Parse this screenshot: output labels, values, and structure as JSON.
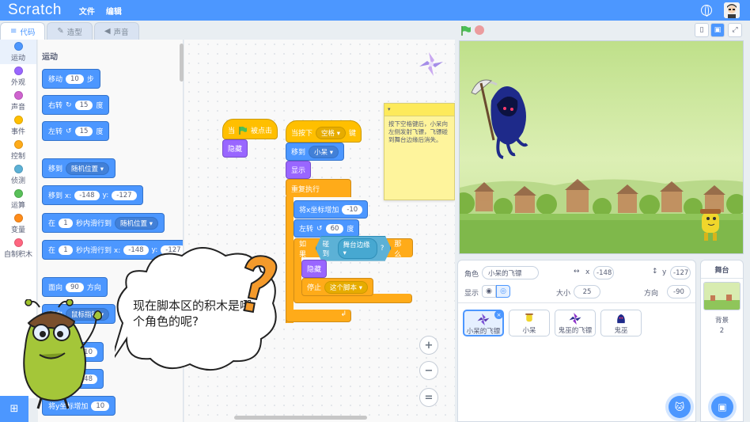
{
  "menu": {
    "logo": "Scratch",
    "file": "文件",
    "edit": "编辑"
  },
  "tabs": {
    "code": "代码",
    "costumes": "造型",
    "sounds": "声音"
  },
  "categories": [
    {
      "label": "运动",
      "color": "#4c97ff"
    },
    {
      "label": "外观",
      "color": "#9966ff"
    },
    {
      "label": "声音",
      "color": "#cf63cf"
    },
    {
      "label": "事件",
      "color": "#ffbf00"
    },
    {
      "label": "控制",
      "color": "#ffab19"
    },
    {
      "label": "侦测",
      "color": "#5cb1d6"
    },
    {
      "label": "运算",
      "color": "#59c059"
    },
    {
      "label": "变量",
      "color": "#ff8c1a"
    },
    {
      "label": "自制积木",
      "color": "#ff6680"
    }
  ],
  "palette": {
    "title": "运动",
    "move": {
      "label": "移动",
      "value": "10",
      "suffix": "步"
    },
    "turn_right": {
      "label": "右转",
      "value": "15",
      "suffix": "度"
    },
    "turn_left": {
      "label": "左转",
      "value": "15",
      "suffix": "度"
    },
    "goto": {
      "label": "移到",
      "option": "随机位置"
    },
    "goto_xy": {
      "label": "移到 x:",
      "x": "-148",
      "y_label": "y:",
      "y": "-127"
    },
    "glide": {
      "prefix": "在",
      "secs": "1",
      "mid": "秒内滑行到",
      "option": "随机位置"
    },
    "glide_xy": {
      "prefix": "在",
      "secs": "1",
      "mid": "秒内滑行到 x:",
      "x": "-148",
      "y_label": "y:",
      "y": "-127"
    },
    "point": {
      "label": "面向",
      "value": "90",
      "suffix": "方向"
    },
    "point_towards": {
      "label": "面向",
      "option": "鼠标指针"
    },
    "change_x_partial": {
      "value": "10"
    },
    "set_x_partial": {
      "value": "-148"
    },
    "change_y_partial": {
      "label": "将y坐标增加",
      "value": "10"
    }
  },
  "script1": {
    "hat_prefix": "当",
    "hat_suffix": "被点击",
    "hide": "隐藏"
  },
  "script2": {
    "hat_prefix": "当按下",
    "key": "空格",
    "hat_suffix": "键",
    "goto_label": "移到",
    "goto_target": "小呆",
    "show": "显示",
    "forever": "重复执行",
    "change_x": "将x坐标增加",
    "change_x_val": "-10",
    "turn": "左转",
    "turn_val": "60",
    "turn_suffix": "度",
    "if_label": "如果",
    "touching": "碰到",
    "touching_target": "舞台边缘",
    "touching_q": "?",
    "then": "那么",
    "hide": "隐藏",
    "stop": "停止",
    "stop_option": "这个脚本"
  },
  "note": {
    "text": "按下空格键后，小呆向左侧发射飞镖，飞镖碰到舞台边缘后消失。"
  },
  "zoom": {
    "in": "+",
    "out": "−",
    "reset": "="
  },
  "sprite_info": {
    "sprite_label": "角色",
    "sprite_name": "小呆的飞镖",
    "x_label": "x",
    "x": "-148",
    "y_label": "y",
    "y": "-127",
    "show_label": "显示",
    "size_label": "大小",
    "size": "25",
    "direction_label": "方向",
    "direction": "-90"
  },
  "sprites": [
    {
      "name": "小呆的飞镖",
      "selected": true
    },
    {
      "name": "小呆",
      "selected": false
    },
    {
      "name": "鬼巫的飞镖",
      "selected": false
    },
    {
      "name": "鬼巫",
      "selected": false
    }
  ],
  "stage_panel": {
    "title": "舞台",
    "backdrop_label": "背景",
    "backdrop_count": "2"
  },
  "bubble": {
    "text": "现在脚本区的积木是哪个角色的呢?",
    "mark": "?"
  }
}
